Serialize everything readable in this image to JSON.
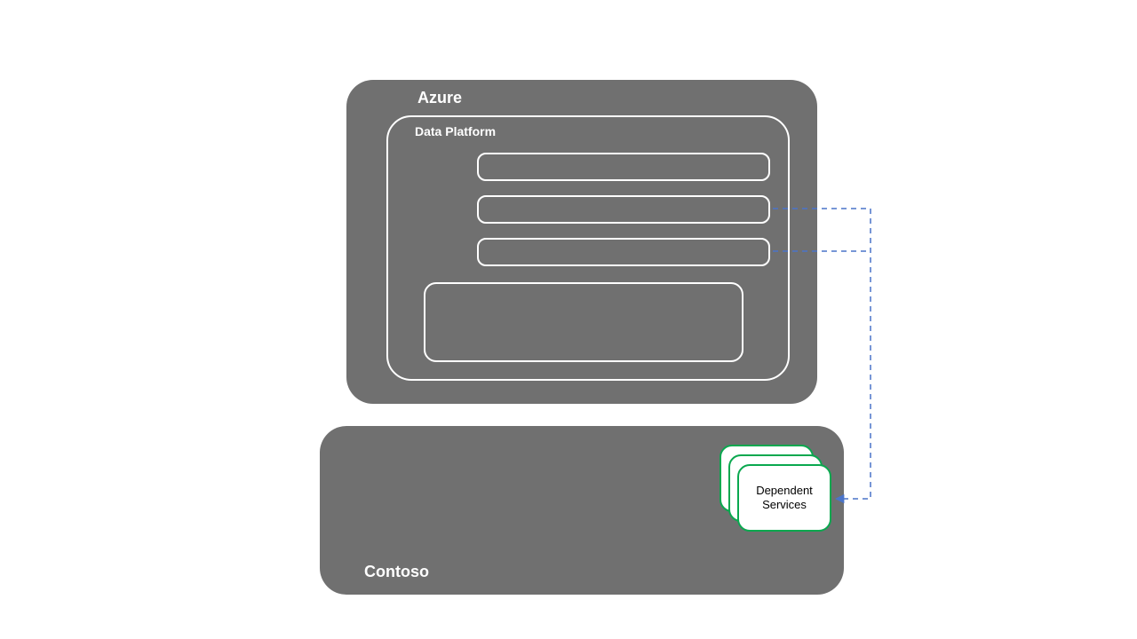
{
  "azure": {
    "label": "Azure"
  },
  "dataPlatform": {
    "label": "Data Platform"
  },
  "contoso": {
    "label": "Contoso"
  },
  "dependentServices": {
    "label_line1": "Dependent",
    "label_line2": "Services"
  },
  "colors": {
    "box": "#707070",
    "outline": "#ffffff",
    "cardBorder": "#0aa84f",
    "connector": "#4a74c9"
  }
}
